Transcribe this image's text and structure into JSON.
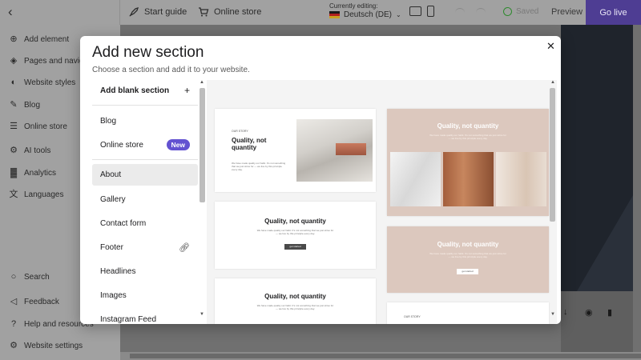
{
  "topbar": {
    "start_guide": "Start guide",
    "online_store": "Online store",
    "currently_editing": "Currently editing:",
    "language": "Deutsch (DE)",
    "saved": "Saved",
    "preview": "Preview",
    "go_live": "Go live"
  },
  "sidebar": {
    "items": [
      {
        "label": "Add element",
        "icon": "plus-circle-icon"
      },
      {
        "label": "Pages and navigation",
        "icon": "layers-icon"
      },
      {
        "label": "Website styles",
        "icon": "palette-icon"
      },
      {
        "label": "Blog",
        "icon": "edit-icon"
      },
      {
        "label": "Online store",
        "icon": "cart-icon"
      },
      {
        "label": "AI tools",
        "icon": "robot-icon"
      },
      {
        "label": "Analytics",
        "icon": "chart-icon"
      },
      {
        "label": "Languages",
        "icon": "translate-icon"
      }
    ],
    "bottom": [
      {
        "label": "Search",
        "icon": "search-icon"
      },
      {
        "label": "Feedback",
        "icon": "megaphone-icon"
      },
      {
        "label": "Help and resources",
        "icon": "help-icon"
      },
      {
        "label": "Website settings",
        "icon": "gear-icon"
      }
    ]
  },
  "modal": {
    "title": "Add new section",
    "subtitle": "Choose a section and add it to your website.",
    "add_blank": "Add blank section",
    "add_blank_icon": "+",
    "items": [
      {
        "label": "Blog"
      },
      {
        "label": "Online store",
        "badge": "New"
      },
      {
        "label": "About",
        "selected": true
      },
      {
        "label": "Gallery"
      },
      {
        "label": "Contact form"
      },
      {
        "label": "Footer",
        "icon": "link-icon"
      },
      {
        "label": "Headlines"
      },
      {
        "label": "Images"
      },
      {
        "label": "Instagram Feed"
      }
    ],
    "preview_heading": "Quality, not quantity",
    "preview_eyebrow": "OUR STORY",
    "preview_body": "We have made quality our habit. It's not something that we just strive for — we live by this principle every day.",
    "preview_button": "get started"
  },
  "colors": {
    "accent": "#6352d1",
    "go_live_bg": "#4e3d93",
    "beige": "#dcc8be"
  }
}
